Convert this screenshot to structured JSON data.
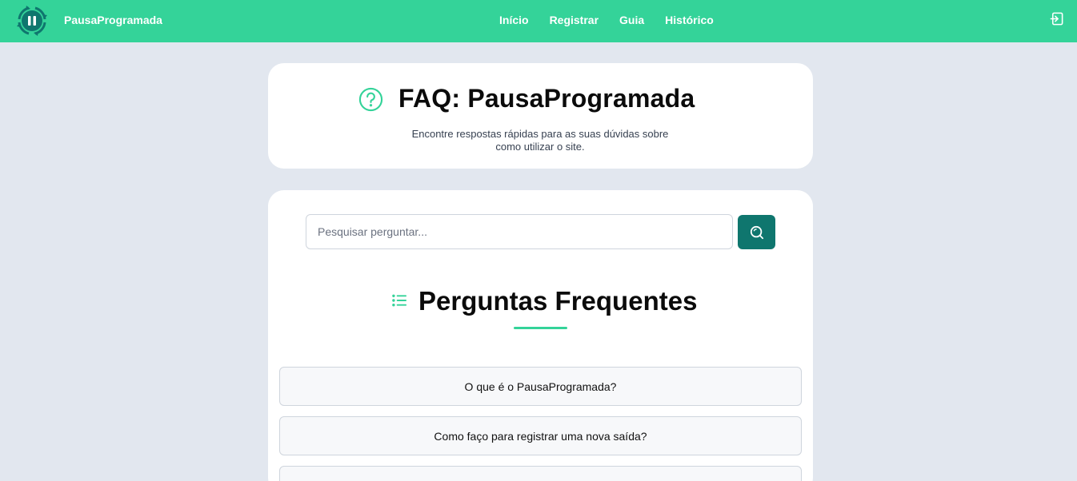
{
  "nav": {
    "brand": "PausaProgramada",
    "links": [
      "Início",
      "Registrar",
      "Guia",
      "Histórico"
    ]
  },
  "header": {
    "title": "FAQ: PausaProgramada",
    "subtitle": "Encontre respostas rápidas para as suas dúvidas sobre como utilizar o site."
  },
  "search": {
    "placeholder": "Pesquisar perguntar...",
    "value": ""
  },
  "section": {
    "title": "Perguntas Frequentes"
  },
  "faq": {
    "items": [
      "O que é o PausaProgramada?",
      "Como faço para registrar uma nova saída?",
      ""
    ]
  },
  "colors": {
    "primary": "#34d399",
    "accent_dark": "#0f766e",
    "background": "#e2e7ef"
  }
}
